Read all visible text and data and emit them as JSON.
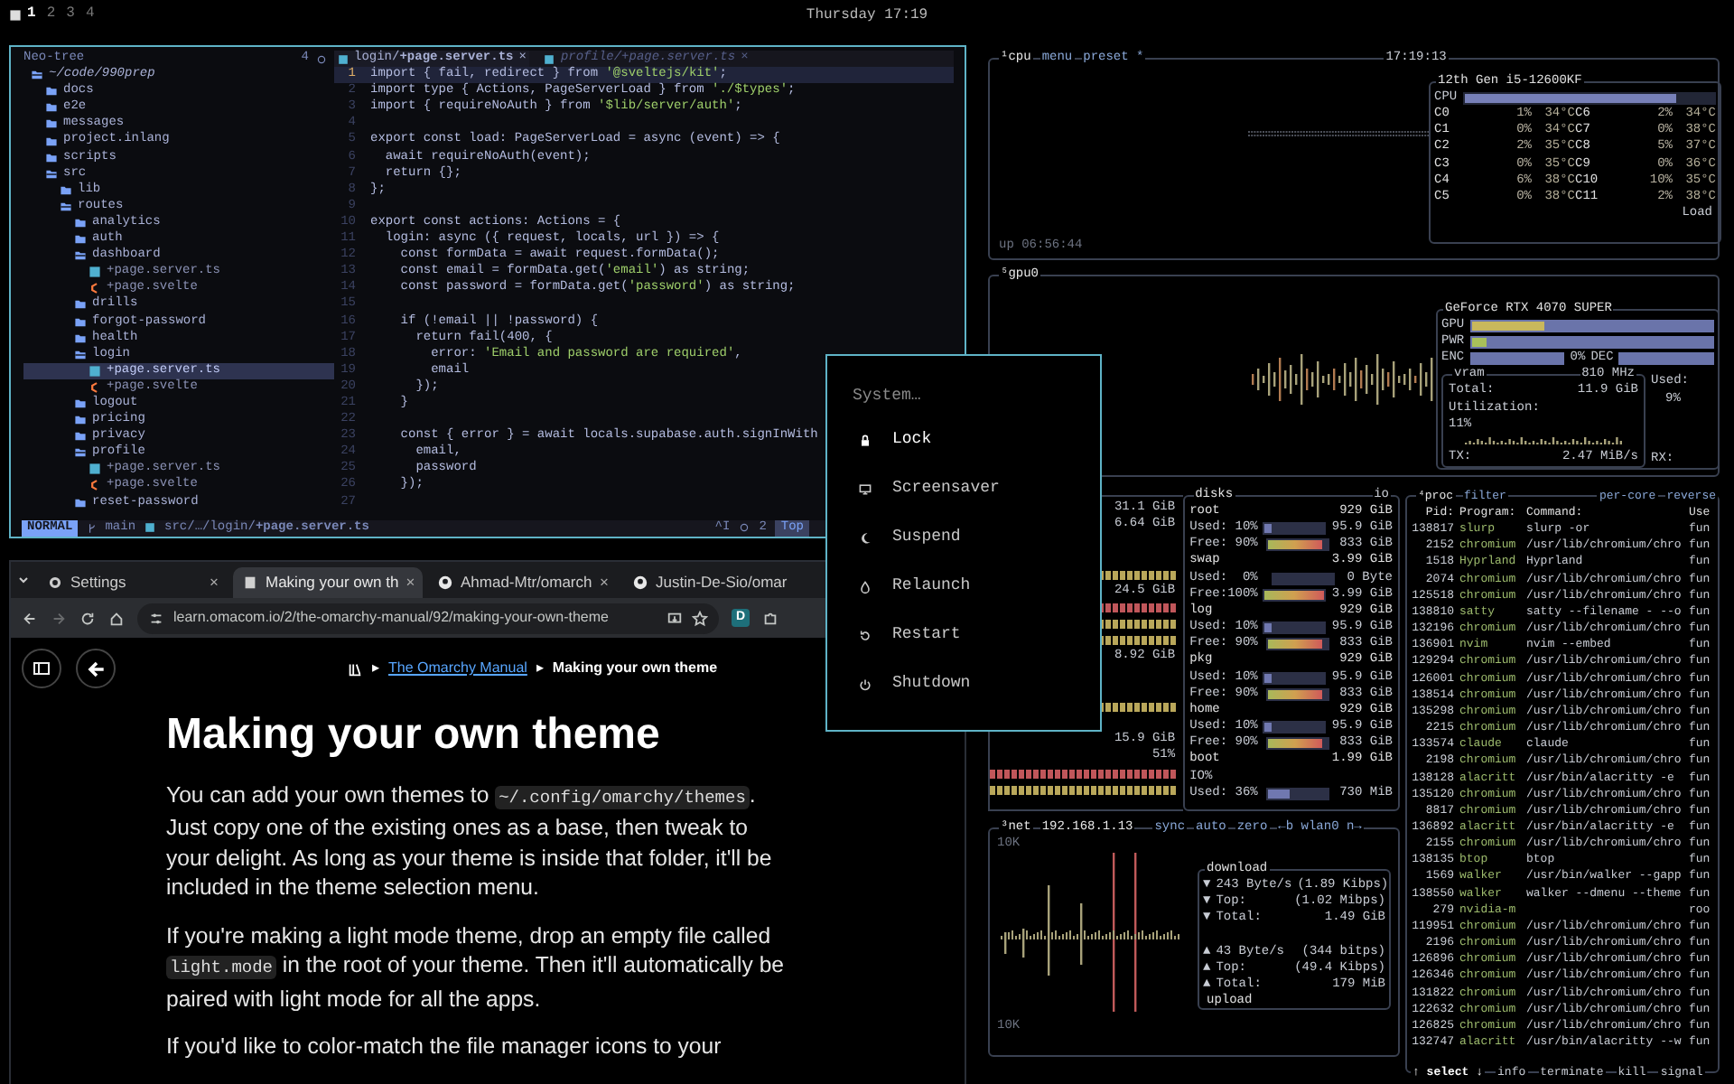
{
  "top_bar": {
    "workspaces": [
      {
        "label": "1",
        "selected": true
      },
      {
        "label": "2",
        "selected": false
      },
      {
        "label": "3",
        "selected": false
      },
      {
        "label": "4",
        "selected": false
      }
    ],
    "clock": "Thursday 17:19"
  },
  "editor": {
    "tree": {
      "title": "Neo-tree",
      "count": "4",
      "root": {
        "name": "~/code/990prep",
        "kind": "folder",
        "expanded": true,
        "selected": false,
        "children": [
          {
            "name": "docs",
            "kind": "folder",
            "expanded": false,
            "selected": false
          },
          {
            "name": "e2e",
            "kind": "folder",
            "expanded": false,
            "selected": false
          },
          {
            "name": "messages",
            "kind": "folder",
            "expanded": false,
            "selected": false
          },
          {
            "name": "project.inlang",
            "kind": "folder",
            "expanded": false,
            "selected": false
          },
          {
            "name": "scripts",
            "kind": "folder",
            "expanded": false,
            "selected": false
          },
          {
            "name": "src",
            "kind": "folder",
            "expanded": true,
            "selected": false,
            "children": [
              {
                "name": "lib",
                "kind": "folder",
                "expanded": false,
                "selected": false
              },
              {
                "name": "routes",
                "kind": "folder",
                "expanded": true,
                "selected": false,
                "children": [
                  {
                    "name": "analytics",
                    "kind": "folder",
                    "expanded": false,
                    "selected": false
                  },
                  {
                    "name": "auth",
                    "kind": "folder",
                    "expanded": false,
                    "selected": false
                  },
                  {
                    "name": "dashboard",
                    "kind": "folder",
                    "expanded": true,
                    "selected": false,
                    "children": [
                      {
                        "name": "+page.server.ts",
                        "kind": "ts",
                        "selected": false
                      },
                      {
                        "name": "+page.svelte",
                        "kind": "svelte",
                        "selected": false
                      }
                    ]
                  },
                  {
                    "name": "drills",
                    "kind": "folder",
                    "expanded": false,
                    "selected": false
                  },
                  {
                    "name": "forgot-password",
                    "kind": "folder",
                    "expanded": false,
                    "selected": false
                  },
                  {
                    "name": "health",
                    "kind": "folder",
                    "expanded": false,
                    "selected": false
                  },
                  {
                    "name": "login",
                    "kind": "folder",
                    "expanded": true,
                    "selected": false,
                    "children": [
                      {
                        "name": "+page.server.ts",
                        "kind": "ts",
                        "selected": true
                      },
                      {
                        "name": "+page.svelte",
                        "kind": "svelte",
                        "selected": false
                      }
                    ]
                  },
                  {
                    "name": "logout",
                    "kind": "folder",
                    "expanded": false,
                    "selected": false
                  },
                  {
                    "name": "pricing",
                    "kind": "folder",
                    "expanded": false,
                    "selected": false
                  },
                  {
                    "name": "privacy",
                    "kind": "folder",
                    "expanded": false,
                    "selected": false
                  },
                  {
                    "name": "profile",
                    "kind": "folder",
                    "expanded": true,
                    "selected": false,
                    "children": [
                      {
                        "name": "+page.server.ts",
                        "kind": "ts",
                        "selected": false
                      },
                      {
                        "name": "+page.svelte",
                        "kind": "svelte",
                        "selected": false
                      }
                    ]
                  },
                  {
                    "name": "reset-password",
                    "kind": "folder",
                    "expanded": false,
                    "selected": false
                  }
                ]
              }
            ]
          }
        ]
      }
    },
    "tabs": [
      {
        "label": "login/**+page.server.ts**",
        "close": "×",
        "selected": true
      },
      {
        "label": "profile/+page.server.ts",
        "close": "×",
        "selected": false
      }
    ],
    "lines": [
      {
        "n": "1",
        "text": "import { fail, redirect } from '@sveltejs/kit';",
        "current": true
      },
      {
        "n": "2",
        "text": "import type { Actions, PageServerLoad } from './$types';",
        "current": false
      },
      {
        "n": "3",
        "text": "import { requireNoAuth } from '$lib/server/auth';",
        "current": false
      },
      {
        "n": "4",
        "current": false
      },
      {
        "n": "5",
        "text": "export const load: PageServerLoad = async (event) => {",
        "current": false
      },
      {
        "n": "6",
        "text": "  await requireNoAuth(event);",
        "current": false
      },
      {
        "n": "7",
        "text": "  return {};",
        "current": false
      },
      {
        "n": "8",
        "text": "};",
        "current": false
      },
      {
        "n": "9",
        "current": false
      },
      {
        "n": "10",
        "text": "export const actions: Actions = {",
        "current": false
      },
      {
        "n": "11",
        "text": "  login: async ({ request, locals, url }) => {",
        "current": false
      },
      {
        "n": "12",
        "text": "    const formData = await request.formData();",
        "current": false
      },
      {
        "n": "13",
        "text": "    const email = formData.get('email') as string;",
        "current": false
      },
      {
        "n": "14",
        "text": "    const password = formData.get('password') as string;",
        "current": false
      },
      {
        "n": "15",
        "current": false
      },
      {
        "n": "16",
        "text": "    if (!email || !password) {",
        "current": false
      },
      {
        "n": "17",
        "text": "      return fail(400, {",
        "current": false
      },
      {
        "n": "18",
        "text": "        error: 'Email and password are required',",
        "current": false
      },
      {
        "n": "19",
        "text": "        email",
        "current": false
      },
      {
        "n": "20",
        "text": "      });",
        "current": false
      },
      {
        "n": "21",
        "text": "    }",
        "current": false
      },
      {
        "n": "22",
        "current": false
      },
      {
        "n": "23",
        "text": "    const { error } = await locals.supabase.auth.signInWith",
        "current": false
      },
      {
        "n": "24",
        "text": "      email,",
        "current": false
      },
      {
        "n": "25",
        "text": "      password",
        "current": false
      },
      {
        "n": "26",
        "text": "    });",
        "current": false
      },
      {
        "n": "27",
        "current": false
      }
    ],
    "status": {
      "mode": "NORMAL",
      "branch": "main",
      "path": "src/…/login/**+page.server.ts**",
      "info": "^I",
      "diagnostics": "2",
      "position": "Top"
    }
  },
  "browser": {
    "tabs": [
      {
        "title": "Settings",
        "close": "×",
        "selected": false
      },
      {
        "title": "Making your own th",
        "close": "×",
        "selected": true
      },
      {
        "title": "Ahmad-Mtr/omarch",
        "close": "×",
        "selected": false
      },
      {
        "title": "Justin-De-Sio/omar",
        "selected": false
      }
    ],
    "toolbar": {
      "back_enabled": true,
      "forward_enabled": false,
      "url": "learn.omacom.io/2/the-omarchy-manual/92/making-your-own-theme",
      "extension": "D"
    },
    "breadcrumb": {
      "separator": "▸",
      "link": "The Omarchy Manual",
      "current": "Making your own theme"
    },
    "heading": "Making your own theme",
    "paragraphs": [
      [
        {
          "text": "You can add your own themes to "
        },
        {
          "code": "~/.config/omarchy/themes"
        },
        {
          "text": ". Just copy one of the existing ones as a base, then tweak to your delight. As long as your theme is inside that folder, it'll be included in the theme selection menu."
        }
      ],
      [
        {
          "text": "If you're making a light mode theme, drop an empty file called "
        },
        {
          "code": "light.mode"
        },
        {
          "text": " in the root of your theme. Then it'll automatically be paired with light mode for all the apps."
        }
      ],
      [
        {
          "text": "If you'd like to color-match the file manager icons to your"
        }
      ]
    ]
  },
  "system_menu": {
    "placeholder": "System…",
    "items": [
      {
        "label": "Lock",
        "selected": true
      },
      {
        "label": "Screensaver",
        "selected": false
      },
      {
        "label": "Suspend",
        "selected": false
      },
      {
        "label": "Relaunch",
        "selected": false
      },
      {
        "label": "Restart",
        "selected": false
      },
      {
        "label": "Shutdown",
        "selected": false
      }
    ]
  },
  "btop": {
    "cpu": {
      "title": "¹cpu",
      "menu": "menu",
      "preset": "preset *",
      "clock": "17:19:13",
      "uptime": "up 06:56:44",
      "model": "12th Gen i5-12600KF",
      "total_label": "CPU",
      "level": 0.85,
      "load": "Load",
      "cores": [
        {
          "name": "C0",
          "pct": "1%",
          "temp": "34°C"
        },
        {
          "name": "C1",
          "pct": "0%",
          "temp": "34°C"
        },
        {
          "name": "C2",
          "pct": "2%",
          "temp": "35°C"
        },
        {
          "name": "C3",
          "pct": "0%",
          "temp": "35°C"
        },
        {
          "name": "C4",
          "pct": "6%",
          "temp": "38°C"
        },
        {
          "name": "C5",
          "pct": "0%",
          "temp": "38°C"
        },
        {
          "name": "C6",
          "pct": "2%",
          "temp": "34°C"
        },
        {
          "name": "C7",
          "pct": "0%",
          "temp": "38°C"
        },
        {
          "name": "C8",
          "pct": "5%",
          "temp": "37°C"
        },
        {
          "name": "C9",
          "pct": "0%",
          "temp": "36°C"
        },
        {
          "name": "C10",
          "pct": "10%",
          "temp": "35°C"
        },
        {
          "name": "C11",
          "pct": "2%",
          "temp": "38°C"
        }
      ]
    },
    "gpu": {
      "title": "⁵gpu0",
      "model": "GeForce RTX 4070 SUPER",
      "meters": [
        {
          "label": "GPU",
          "level": 0.3,
          "color": "#c9b85c"
        },
        {
          "label": "PWR",
          "level": 0.06,
          "color": "#a8c05a"
        }
      ],
      "codecs": [
        {
          "label": "ENC",
          "reading": "0%"
        },
        {
          "label": "DEC"
        }
      ],
      "vram": {
        "title": "vram",
        "clock": "810 MHz",
        "total_label": "Total:",
        "total": "11.9 GiB",
        "used_label": "Used:",
        "used": "9%",
        "util_label": "Utilization:",
        "util": "11%",
        "tx_label": "TX:",
        "tx": "2.47 MiB/s",
        "rx_label": "RX:"
      }
    },
    "mem": [
      {
        "kind": "value",
        "text": "31.1 GiB"
      },
      {
        "kind": "value",
        "text": "6.64 GiB"
      },
      {
        "kind": "gap"
      },
      {
        "kind": "gap"
      },
      {
        "kind": "meter",
        "color": "#b9a75a"
      },
      {
        "kind": "value",
        "text": "24.5 GiB"
      },
      {
        "kind": "meter",
        "color": "#c0565a"
      },
      {
        "kind": "meter",
        "color": "#b9a75a"
      },
      {
        "kind": "meter",
        "color": "#b9a75a"
      },
      {
        "kind": "value",
        "text": "8.92 GiB"
      },
      {
        "kind": "gap"
      },
      {
        "kind": "gap"
      },
      {
        "kind": "meter",
        "color": "#b9a75a"
      },
      {
        "kind": "gap"
      },
      {
        "kind": "value",
        "text": "15.9 GiB"
      },
      {
        "kind": "value",
        "text": "51%"
      },
      {
        "kind": "meter",
        "color": "#c0565a"
      },
      {
        "kind": "meter",
        "color": "#b9a75a"
      }
    ],
    "disks": {
      "title": "disks",
      "io": "io",
      "items": [
        {
          "name": "root",
          "size": "929 GiB",
          "rows": [
            {
              "kind": "used",
              "label": "Used: 10%",
              "level": 0.1,
              "value": "95.9 GiB"
            },
            {
              "kind": "free",
              "label": "Free: 90%",
              "level": 0.9,
              "value": "833 GiB"
            }
          ]
        },
        {
          "name": "swap",
          "size": "3.99 GiB",
          "rows": [
            {
              "kind": "used",
              "label": "Used:  0%",
              "level": 0,
              "value": "0 Byte"
            },
            {
              "kind": "free",
              "label": "Free:100%",
              "level": 1,
              "value": "3.99 GiB"
            }
          ]
        },
        {
          "name": "log",
          "size": "929 GiB",
          "rows": [
            {
              "kind": "used",
              "label": "Used: 10%",
              "level": 0.1,
              "value": "95.9 GiB"
            },
            {
              "kind": "free",
              "label": "Free: 90%",
              "level": 0.9,
              "value": "833 GiB"
            }
          ]
        },
        {
          "name": "pkg",
          "size": "929 GiB",
          "rows": [
            {
              "kind": "used",
              "label": "Used: 10%",
              "level": 0.1,
              "value": "95.9 GiB"
            },
            {
              "kind": "free",
              "label": "Free: 90%",
              "level": 0.9,
              "value": "833 GiB"
            }
          ]
        },
        {
          "name": "home",
          "size": "929 GiB",
          "rows": [
            {
              "kind": "used",
              "label": "Used: 10%",
              "level": 0.1,
              "value": "95.9 GiB"
            },
            {
              "kind": "free",
              "label": "Free: 90%",
              "level": 0.9,
              "value": "833 GiB"
            }
          ]
        },
        {
          "name": "boot",
          "size": "1.99 GiB",
          "rows": [
            {
              "kind": "io",
              "label": "IO%"
            },
            {
              "kind": "used",
              "label": "Used: 36%",
              "level": 0.36,
              "value": "730 MiB"
            }
          ]
        }
      ]
    },
    "net": {
      "title": "³net",
      "ip": "192.168.1.13",
      "options": [
        "sync",
        "auto",
        "zero",
        "←b wlan0 n→"
      ],
      "scale_top": "10K",
      "scale_bottom": "10K",
      "download": {
        "title": "download",
        "rows": [
          {
            "arrow": "▼",
            "label": "243 Byte/s",
            "value": "(1.89 Kibps)"
          },
          {
            "arrow": "▼",
            "label": "Top:",
            "value": "(1.02 Mibps)"
          },
          {
            "arrow": "▼",
            "label": "Total:",
            "value": "1.49 GiB"
          }
        ]
      },
      "upload": {
        "title": "upload",
        "rows": [
          {
            "arrow": "▲",
            "label": "43 Byte/s",
            "value": "(344 bitps)"
          },
          {
            "arrow": "▲",
            "label": "Top:",
            "value": "(49.4 Kibps)"
          },
          {
            "arrow": "▲",
            "label": "Total:",
            "value": "179 MiB"
          }
        ]
      }
    },
    "proc": {
      "title": "⁴proc",
      "filter": "filter",
      "per_core": "per-core",
      "reverse": "reverse",
      "columns": [
        "Pid:",
        "Program:",
        "Command:",
        "Use"
      ],
      "rows": [
        {
          "pid": "138817",
          "program": "slurp",
          "command": "slurp -or",
          "user": "fun"
        },
        {
          "pid": "2152",
          "program": "chromium",
          "command": "/usr/lib/chromium/chro",
          "user": "fun"
        },
        {
          "pid": "1518",
          "program": "Hyprland",
          "command": "Hyprland",
          "user": "fun"
        },
        {
          "pid": "2074",
          "program": "chromium",
          "command": "/usr/lib/chromium/chro",
          "user": "fun"
        },
        {
          "pid": "125518",
          "program": "chromium",
          "command": "/usr/lib/chromium/chro",
          "user": "fun"
        },
        {
          "pid": "138810",
          "program": "satty",
          "command": "satty --filename - --o",
          "user": "fun"
        },
        {
          "pid": "132196",
          "program": "chromium",
          "command": "/usr/lib/chromium/chro",
          "user": "fun"
        },
        {
          "pid": "136901",
          "program": "nvim",
          "command": "nvim --embed",
          "user": "fun"
        },
        {
          "pid": "129294",
          "program": "chromium",
          "command": "/usr/lib/chromium/chro",
          "user": "fun"
        },
        {
          "pid": "126001",
          "program": "chromium",
          "command": "/usr/lib/chromium/chro",
          "user": "fun"
        },
        {
          "pid": "138514",
          "program": "chromium",
          "command": "/usr/lib/chromium/chro",
          "user": "fun"
        },
        {
          "pid": "135298",
          "program": "chromium",
          "command": "/usr/lib/chromium/chro",
          "user": "fun"
        },
        {
          "pid": "2215",
          "program": "chromium",
          "command": "/usr/lib/chromium/chro",
          "user": "fun"
        },
        {
          "pid": "133574",
          "program": "claude",
          "command": "claude",
          "user": "fun"
        },
        {
          "pid": "2198",
          "program": "chromium",
          "command": "/usr/lib/chromium/chro",
          "user": "fun"
        },
        {
          "pid": "138128",
          "program": "alacritt",
          "command": "/usr/bin/alacritty -e",
          "user": "fun"
        },
        {
          "pid": "135120",
          "program": "chromium",
          "command": "/usr/lib/chromium/chro",
          "user": "fun"
        },
        {
          "pid": "8817",
          "program": "chromium",
          "command": "/usr/lib/chromium/chro",
          "user": "fun"
        },
        {
          "pid": "136892",
          "program": "alacritt",
          "command": "/usr/bin/alacritty -e",
          "user": "fun"
        },
        {
          "pid": "2155",
          "program": "chromium",
          "command": "/usr/lib/chromium/chro",
          "user": "fun"
        },
        {
          "pid": "138135",
          "program": "btop",
          "command": "btop",
          "user": "fun"
        },
        {
          "pid": "1569",
          "program": "walker",
          "command": "/usr/bin/walker --gapp",
          "user": "fun"
        },
        {
          "pid": "138550",
          "program": "walker",
          "command": "walker --dmenu --theme",
          "user": "fun"
        },
        {
          "pid": "279",
          "program": "nvidia-m",
          "user": "roo"
        },
        {
          "pid": "119951",
          "program": "chromium",
          "command": "/usr/lib/chromium/chro",
          "user": "fun"
        },
        {
          "pid": "2196",
          "program": "chromium",
          "command": "/usr/lib/chromium/chro",
          "user": "fun"
        },
        {
          "pid": "126896",
          "program": "chromium",
          "command": "/usr/lib/chromium/chro",
          "user": "fun"
        },
        {
          "pid": "126346",
          "program": "chromium",
          "command": "/usr/lib/chromium/chro",
          "user": "fun"
        },
        {
          "pid": "131822",
          "program": "chromium",
          "command": "/usr/lib/chromium/chro",
          "user": "fun"
        },
        {
          "pid": "122632",
          "program": "chromium",
          "command": "/usr/lib/chromium/chro",
          "user": "fun"
        },
        {
          "pid": "126825",
          "program": "chromium",
          "command": "/usr/lib/chromium/chro",
          "user": "fun"
        },
        {
          "pid": "132747",
          "program": "alacritt",
          "command": "/usr/bin/alacritty --w",
          "user": "fun"
        }
      ],
      "footer": [
        "↑ select ↓",
        "info",
        "terminate",
        "kill",
        "signal"
      ]
    }
  }
}
